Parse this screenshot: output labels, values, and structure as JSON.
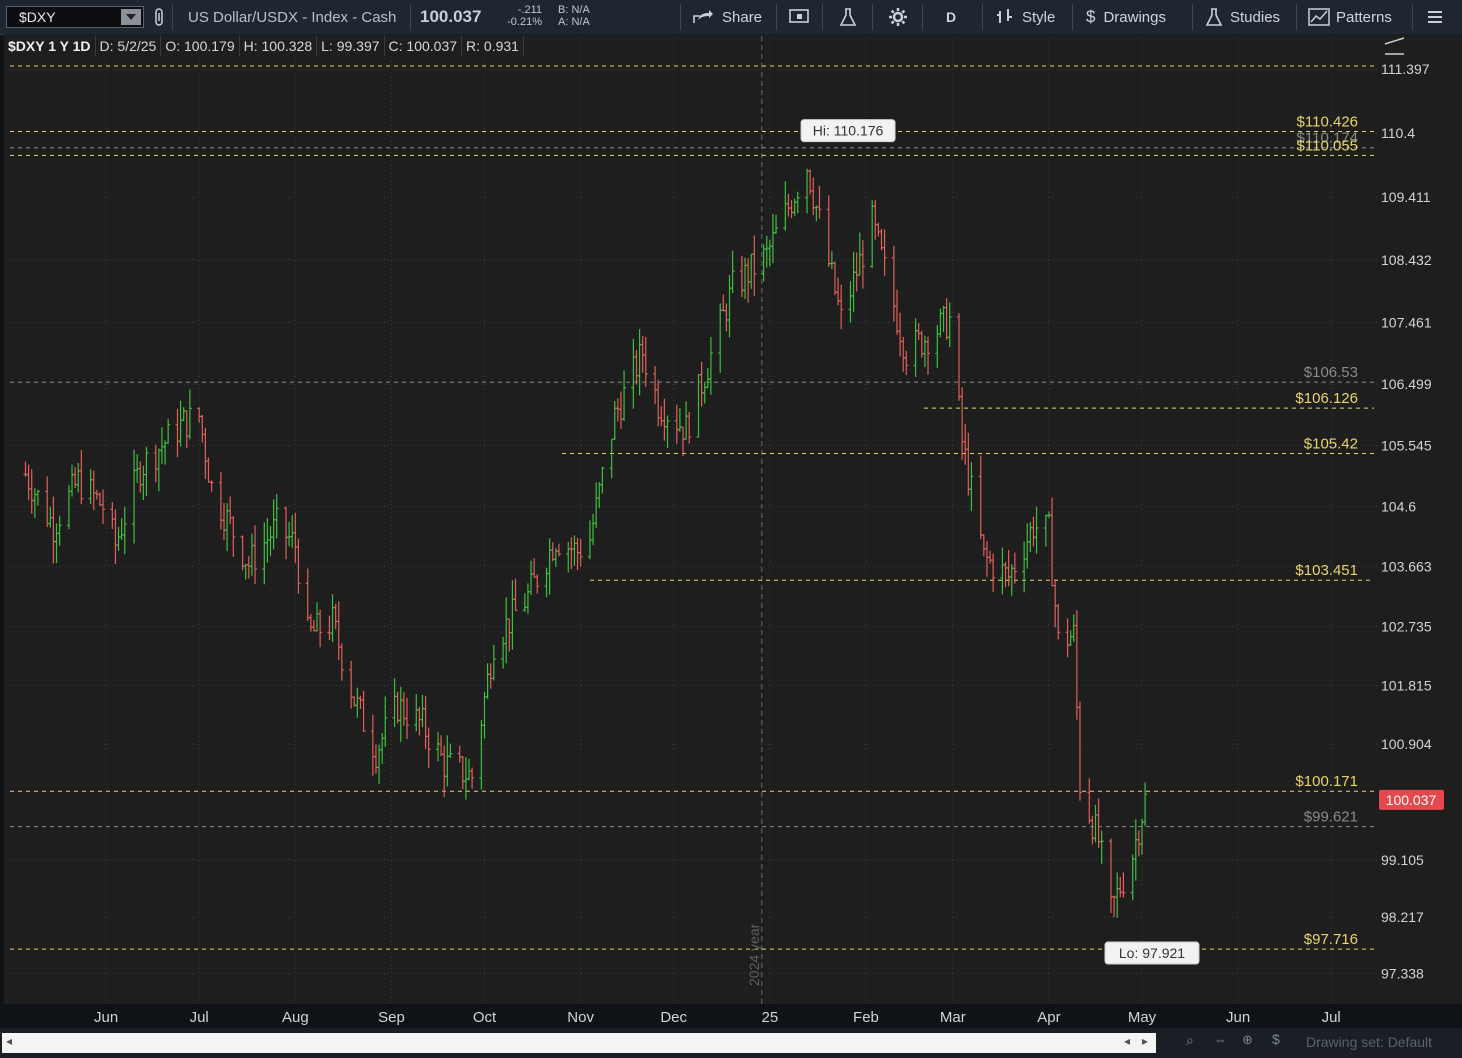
{
  "toolbar": {
    "symbol": "$DXY",
    "description": "US Dollar/USDX - Index - Cash",
    "last": "100.037",
    "change": "-.211",
    "change_pct": "-0.21%",
    "bid": "B: N/A",
    "ask": "A: N/A",
    "share_label": "Share",
    "period_label": "D",
    "style_label": "Style",
    "drawings_label": "Drawings",
    "studies_label": "Studies",
    "patterns_label": "Patterns"
  },
  "info": {
    "title": "$DXY 1 Y 1D",
    "date": "D: 5/2/25",
    "open": "O: 100.179",
    "high": "H: 100.328",
    "low": "L: 99.397",
    "close": "C: 100.037",
    "range": "R: 0.931"
  },
  "bottom": {
    "drawing_set": "Drawing set: Default"
  },
  "colors": {
    "up": "#3fbf3f",
    "down": "#e0605a",
    "level_yellow": "#e8d66a",
    "level_gray": "#8a8a8a",
    "price_tag": "#e5484d"
  },
  "chart_data": {
    "type": "ohlc",
    "title": "$DXY 1 Y 1D",
    "x_ticks": [
      "Jun",
      "Jul",
      "Aug",
      "Sep",
      "Oct",
      "Nov",
      "Dec",
      "25",
      "Feb",
      "Mar",
      "Apr",
      "May",
      "Jun",
      "Jul"
    ],
    "y_ticks": [
      "111.397",
      "110.4",
      "109.411",
      "108.432",
      "107.461",
      "106.499",
      "105.545",
      "104.6",
      "103.663",
      "102.735",
      "101.815",
      "100.904",
      "99.105",
      "98.217",
      "97.338"
    ],
    "y_range": [
      97.05,
      111.6
    ],
    "year_marker": "2024 year",
    "high_label": "Hi: 110.176",
    "low_label": "Lo: 97.921",
    "last_price": "100.037",
    "levels": [
      {
        "label": "$110.426",
        "price": 110.426,
        "color": "yellow"
      },
      {
        "label": "$110.174",
        "price": 110.174,
        "color": "gray"
      },
      {
        "label": "$110.055",
        "price": 110.055,
        "color": "yellow"
      },
      {
        "label": "$106.53",
        "price": 106.53,
        "color": "gray"
      },
      {
        "label": "$106.126",
        "price": 106.126,
        "color": "yellow"
      },
      {
        "label": "$105.42",
        "price": 105.42,
        "color": "yellow"
      },
      {
        "label": "$103.451",
        "price": 103.451,
        "color": "yellow"
      },
      {
        "label": "$100.171",
        "price": 100.171,
        "color": "yellow"
      },
      {
        "label": "$99.621",
        "price": 99.621,
        "color": "gray"
      },
      {
        "label": "$97.716",
        "price": 97.716,
        "color": "yellow"
      }
    ],
    "path": [
      [
        "2024-05-06",
        105.1
      ],
      [
        "2024-05-15",
        104.3
      ],
      [
        "2024-05-23",
        105.0
      ],
      [
        "2024-05-31",
        104.6
      ],
      [
        "2024-06-04",
        104.0
      ],
      [
        "2024-06-12",
        105.2
      ],
      [
        "2024-06-26",
        105.9
      ],
      [
        "2024-07-01",
        106.0
      ],
      [
        "2024-07-05",
        104.9
      ],
      [
        "2024-07-17",
        103.7
      ],
      [
        "2024-07-26",
        104.3
      ],
      [
        "2024-08-01",
        104.0
      ],
      [
        "2024-08-05",
        102.6
      ],
      [
        "2024-08-13",
        102.8
      ],
      [
        "2024-08-20",
        101.6
      ],
      [
        "2024-08-27",
        100.8
      ],
      [
        "2024-09-03",
        101.5
      ],
      [
        "2024-09-11",
        101.2
      ],
      [
        "2024-09-18",
        100.6
      ],
      [
        "2024-09-27",
        100.4
      ],
      [
        "2024-10-04",
        102.5
      ],
      [
        "2024-10-15",
        103.2
      ],
      [
        "2024-10-24",
        104.1
      ],
      [
        "2024-10-31",
        103.9
      ],
      [
        "2024-11-04",
        104.1
      ],
      [
        "2024-11-12",
        106.0
      ],
      [
        "2024-11-21",
        107.0
      ],
      [
        "2024-11-26",
        106.2
      ],
      [
        "2024-12-05",
        105.8
      ],
      [
        "2024-12-12",
        106.8
      ],
      [
        "2024-12-20",
        108.0
      ],
      [
        "2024-12-31",
        108.5
      ],
      [
        "2025-01-13",
        109.9
      ],
      [
        "2025-01-24",
        107.5
      ],
      [
        "2025-02-03",
        109.0
      ],
      [
        "2025-02-14",
        107.0
      ],
      [
        "2025-02-28",
        107.5
      ],
      [
        "2025-03-04",
        105.6
      ],
      [
        "2025-03-11",
        103.8
      ],
      [
        "2025-03-19",
        103.5
      ],
      [
        "2025-03-27",
        104.3
      ],
      [
        "2025-04-01",
        104.2
      ],
      [
        "2025-04-04",
        102.5
      ],
      [
        "2025-04-09",
        102.6
      ],
      [
        "2025-04-11",
        100.3
      ],
      [
        "2025-04-17",
        99.4
      ],
      [
        "2025-04-21",
        98.3
      ],
      [
        "2025-04-28",
        99.2
      ],
      [
        "2025-05-02",
        100.04
      ]
    ]
  }
}
